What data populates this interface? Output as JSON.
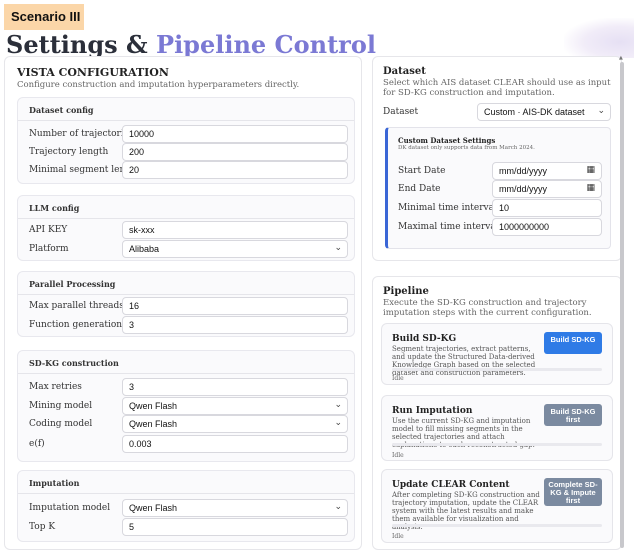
{
  "scenario_label": "Scenario III",
  "title_main": "Settings & ",
  "title_accent": "Pipeline Control",
  "vista": {
    "heading": "VISTA CONFIGURATION",
    "desc": "Configure construction and imputation hyperparameters directly.",
    "dataset_config": {
      "heading": "Dataset config",
      "num_traj_label": "Number of trajectories",
      "num_traj": "10000",
      "traj_len_label": "Trajectory length",
      "traj_len": "200",
      "min_seg_label": "Minimal segment length",
      "min_seg": "20"
    },
    "llm_config": {
      "heading": "LLM config",
      "api_key_label": "API KEY",
      "api_key": "sk-xxx",
      "platform_label": "Platform",
      "platform": "Alibaba"
    },
    "parallel": {
      "heading": "Parallel Processing",
      "threads_label": "Max parallel threads",
      "threads": "16",
      "retries_label": "Function generation retries",
      "retries": "3"
    },
    "sdkg": {
      "heading": "SD-KG construction",
      "max_retries_label": "Max retries",
      "max_retries": "3",
      "mining_label": "Mining model",
      "mining": "Qwen Flash",
      "coding_label": "Coding model",
      "coding": "Qwen Flash",
      "ef_label": "e(f)",
      "ef": "0.003"
    },
    "imputation": {
      "heading": "Imputation",
      "model_label": "Imputation model",
      "model": "Qwen Flash",
      "topk_label": "Top K",
      "topk": "5"
    }
  },
  "dataset": {
    "heading": "Dataset",
    "desc": "Select which AIS dataset CLEAR should use as input for SD-KG construction and imputation.",
    "select_label": "Dataset",
    "selected": "Custom · AIS-DK dataset",
    "custom": {
      "heading": "Custom Dataset Settings",
      "note": "DK dataset only supports data from March 2024.",
      "start_label": "Start Date",
      "start": "mm/dd/yyyy",
      "end_label": "End Date",
      "end": "mm/dd/yyyy",
      "min_interval_label": "Minimal time interval",
      "min_interval": "10",
      "max_interval_label": "Maximal time interval",
      "max_interval": "1000000000"
    }
  },
  "pipeline": {
    "heading": "Pipeline",
    "desc": "Execute the SD-KG construction and trajectory imputation steps with the current configuration.",
    "steps": [
      {
        "title": "Build SD-KG",
        "desc": "Segment trajectories, extract patterns, and update the Structured Data-derived Knowledge Graph based on the selected dataset and construction parameters.",
        "button": "Build SD-KG",
        "status": "Idle",
        "button_color": "#2f7be6"
      },
      {
        "title": "Run Imputation",
        "desc": "Use the current SD-KG and imputation model to fill missing segments in the selected trajectories and attach explanations to each reconstructed gap.",
        "button": "Build SD-KG first",
        "status": "Idle",
        "button_color": "#7b8aa0"
      },
      {
        "title": "Update CLEAR Content",
        "desc": "After completing SD-KG construction and trajectory imputation, update the CLEAR system with the latest results and make them available for visualization and analysis.",
        "button": "Complete SD-KG & Impute first",
        "status": "Idle",
        "button_color": "#7b8aa0"
      }
    ]
  },
  "icons": {
    "chevron": "chevron-down-icon",
    "calendar": "calendar-icon"
  }
}
